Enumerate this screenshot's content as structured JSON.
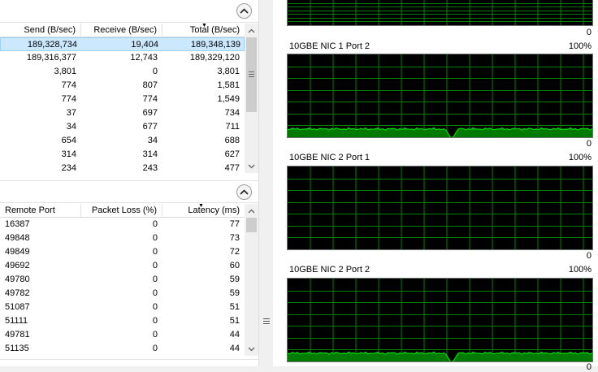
{
  "top_table": {
    "columns": [
      {
        "label": "Send (B/sec)"
      },
      {
        "label": "Receive (B/sec)"
      },
      {
        "label": "Total (B/sec)"
      }
    ],
    "sort_column_index": 2,
    "rows": [
      {
        "send": "189,328,734",
        "receive": "19,404",
        "total": "189,348,139"
      },
      {
        "send": "189,316,377",
        "receive": "12,743",
        "total": "189,329,120"
      },
      {
        "send": "3,801",
        "receive": "0",
        "total": "3,801"
      },
      {
        "send": "774",
        "receive": "807",
        "total": "1,581"
      },
      {
        "send": "774",
        "receive": "774",
        "total": "1,549"
      },
      {
        "send": "37",
        "receive": "697",
        "total": "734"
      },
      {
        "send": "34",
        "receive": "677",
        "total": "711"
      },
      {
        "send": "654",
        "receive": "34",
        "total": "688"
      },
      {
        "send": "314",
        "receive": "314",
        "total": "627"
      },
      {
        "send": "234",
        "receive": "243",
        "total": "477"
      }
    ],
    "selected_row": 0
  },
  "bottom_table": {
    "columns": [
      {
        "label": "Remote Port"
      },
      {
        "label": "Packet Loss (%)"
      },
      {
        "label": "Latency (ms)"
      }
    ],
    "sort_column_index": 2,
    "rows": [
      {
        "port": "16387",
        "loss": "0",
        "latency": "77"
      },
      {
        "port": "49848",
        "loss": "0",
        "latency": "73"
      },
      {
        "port": "49849",
        "loss": "0",
        "latency": "72"
      },
      {
        "port": "49692",
        "loss": "0",
        "latency": "60"
      },
      {
        "port": "49780",
        "loss": "0",
        "latency": "59"
      },
      {
        "port": "49782",
        "loss": "0",
        "latency": "59"
      },
      {
        "port": "51087",
        "loss": "0",
        "latency": "51"
      },
      {
        "port": "51111",
        "loss": "0",
        "latency": "51"
      },
      {
        "port": "49781",
        "loss": "0",
        "latency": "44"
      },
      {
        "port": "51135",
        "loss": "0",
        "latency": "44"
      }
    ]
  },
  "graphs": {
    "first_partial": {
      "zero_label": "0"
    },
    "panels": [
      {
        "label": "10GBE NIC 1 Port 2",
        "max_label": "100%",
        "min_label": "0",
        "utilization_pct": 10,
        "dip": true
      },
      {
        "label": "10GBE NIC 2 Port 1",
        "max_label": "100%",
        "min_label": "0",
        "utilization_pct": 0,
        "dip": false
      },
      {
        "label": "10GBE NIC 2 Port 2",
        "max_label": "100%",
        "min_label": "0",
        "utilization_pct": 10,
        "dip": true
      }
    ]
  },
  "colors": {
    "graph_bg": "#000000",
    "grid": "#008000",
    "trace": "#00e000",
    "selection": "#cce8ff"
  }
}
